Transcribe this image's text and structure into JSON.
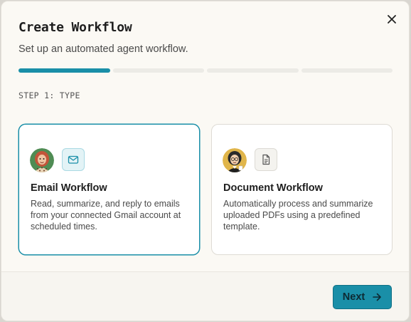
{
  "dialog": {
    "title": "Create Workflow",
    "subtitle": "Set up an automated agent workflow."
  },
  "progress": {
    "total_steps": 4,
    "current_step": 1
  },
  "step": {
    "label": "STEP 1: TYPE"
  },
  "options": [
    {
      "title": "Email Workflow",
      "description": "Read, summarize, and reply to emails from your connected Gmail account at scheduled times.",
      "icon": "mail-icon",
      "selected": true
    },
    {
      "title": "Document Workflow",
      "description": "Automatically process and summarize uploaded PDFs using a predefined template.",
      "icon": "document-icon",
      "selected": false
    }
  ],
  "footer": {
    "next_label": "Next"
  },
  "colors": {
    "accent": "#1a8fa8",
    "background": "#fbf9f4"
  }
}
